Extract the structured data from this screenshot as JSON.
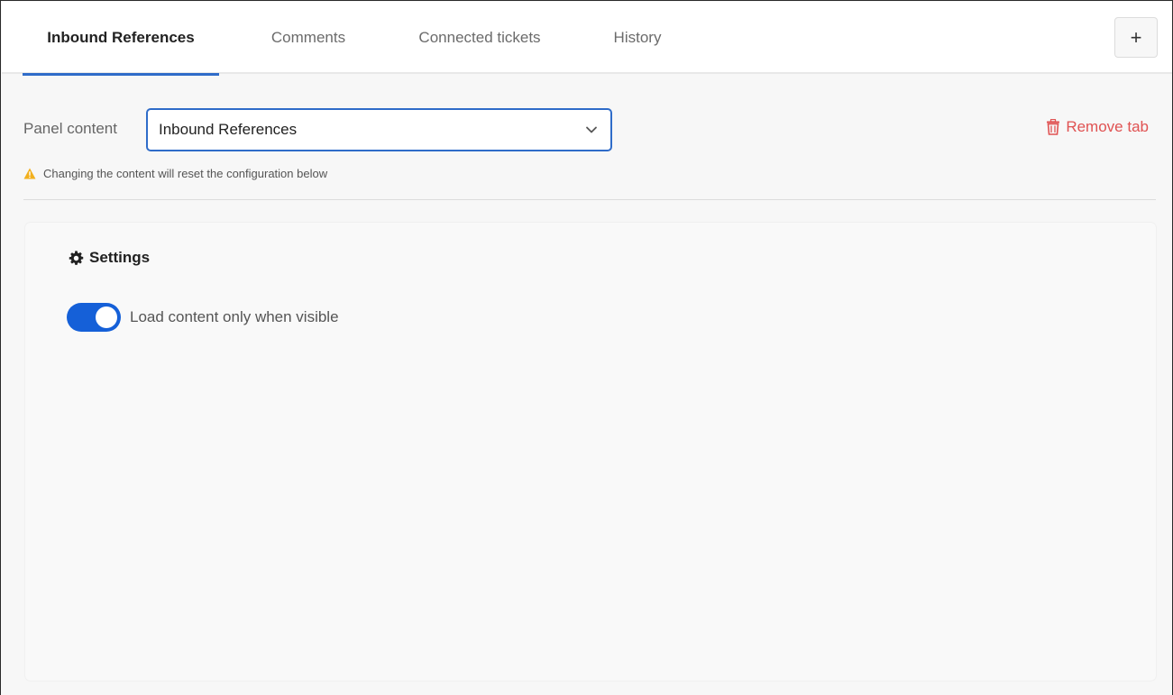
{
  "tabs": [
    {
      "label": "Inbound References",
      "active": true
    },
    {
      "label": "Comments",
      "active": false
    },
    {
      "label": "Connected tickets",
      "active": false
    },
    {
      "label": "History",
      "active": false
    }
  ],
  "add_tab_label": "+",
  "panel": {
    "label": "Panel content",
    "selected": "Inbound References",
    "remove_label": "Remove tab",
    "warning": "Changing the content will reset the configuration below"
  },
  "settings": {
    "title": "Settings",
    "toggle_label": "Load content only when visible",
    "toggle_on": true
  },
  "colors": {
    "accent": "#2f6cc9",
    "toggle": "#1560d8",
    "danger": "#e05252",
    "warning": "#f2b01e"
  }
}
